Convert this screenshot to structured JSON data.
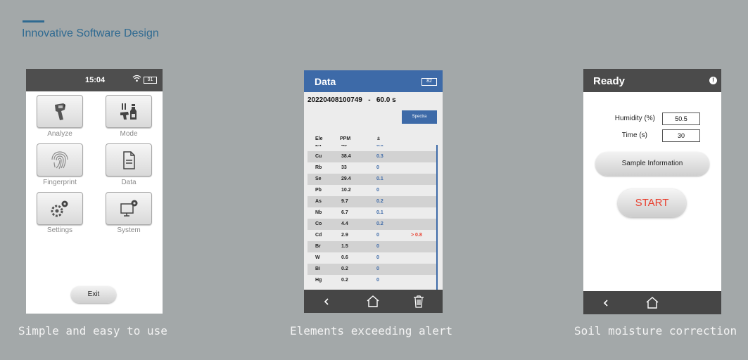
{
  "header": {
    "title": "Innovative Software Design"
  },
  "captions": [
    "Simple and easy to use",
    "Elements exceeding alert",
    "Soil moisture correction"
  ],
  "colors": {
    "accent": "#2f6a91",
    "header_blue": "#3d6aa8",
    "alert_red": "#e8402f",
    "value_blue": "#3d6aa8"
  },
  "screen1": {
    "time": "15:04",
    "battery": "91",
    "tiles": [
      {
        "label": "Analyze",
        "icon": "analyzer-gun-icon"
      },
      {
        "label": "Mode",
        "icon": "mode-sample-icon"
      },
      {
        "label": "Fingerprint",
        "icon": "fingerprint-icon"
      },
      {
        "label": "Data",
        "icon": "document-icon"
      },
      {
        "label": "Settings",
        "icon": "gears-icon"
      },
      {
        "label": "System",
        "icon": "computer-gear-icon"
      }
    ],
    "exit_label": "Exit"
  },
  "screen2": {
    "title": "Data",
    "battery": "82",
    "sample_id": "20220408100749   -   60.0 s",
    "spectra_label": "Spectra",
    "columns": [
      "Ele",
      "PPM",
      "±"
    ],
    "rows": [
      {
        "ele": "Zn",
        "ppm": "45",
        "err": "0.1",
        "alert": ""
      },
      {
        "ele": "Cu",
        "ppm": "38.4",
        "err": "0.3",
        "alert": ""
      },
      {
        "ele": "Rb",
        "ppm": "33",
        "err": "0",
        "alert": ""
      },
      {
        "ele": "Se",
        "ppm": "29.4",
        "err": "0.1",
        "alert": ""
      },
      {
        "ele": "Pb",
        "ppm": "10.2",
        "err": "0",
        "alert": ""
      },
      {
        "ele": "As",
        "ppm": "9.7",
        "err": "0.2",
        "alert": ""
      },
      {
        "ele": "Nb",
        "ppm": "6.7",
        "err": "0.1",
        "alert": ""
      },
      {
        "ele": "Co",
        "ppm": "4.4",
        "err": "0.2",
        "alert": ""
      },
      {
        "ele": "Cd",
        "ppm": "2.9",
        "err": "0",
        "alert": "> 0.8"
      },
      {
        "ele": "Br",
        "ppm": "1.5",
        "err": "0",
        "alert": ""
      },
      {
        "ele": "W",
        "ppm": "0.6",
        "err": "0",
        "alert": ""
      },
      {
        "ele": "Bi",
        "ppm": "0.2",
        "err": "0",
        "alert": ""
      },
      {
        "ele": "Hg",
        "ppm": "0.2",
        "err": "0",
        "alert": ""
      }
    ],
    "nav_icons": [
      "back-arrow-icon",
      "home-icon",
      "trash-icon"
    ]
  },
  "screen3": {
    "title": "Ready",
    "info_icon": "!",
    "humidity_label": "Humidity (%)",
    "humidity_value": "50.5",
    "time_label": "Time (s)",
    "time_value": "30",
    "sample_info_label": "Sample Information",
    "start_label": "START",
    "nav_icons": [
      "back-arrow-icon",
      "home-icon"
    ]
  }
}
